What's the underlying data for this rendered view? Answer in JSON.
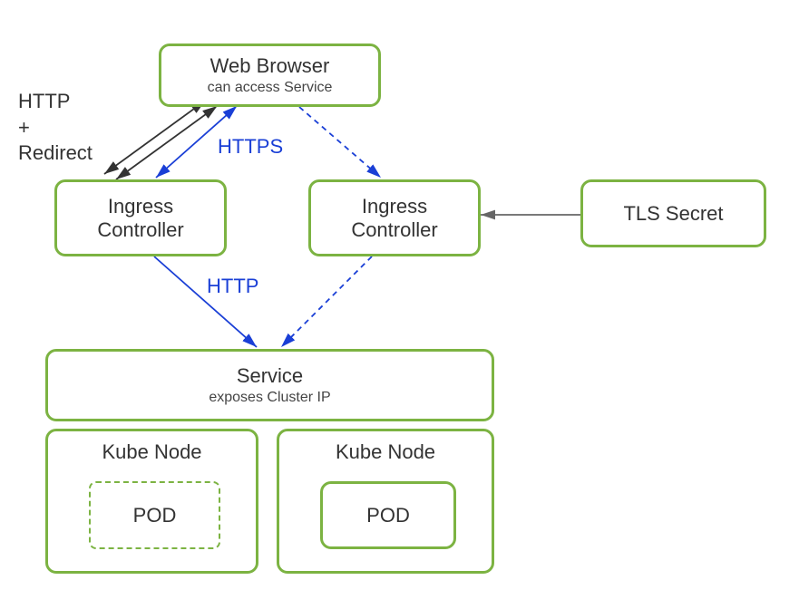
{
  "webBrowser": {
    "title": "Web Browser",
    "subtitle": "can access Service"
  },
  "ingressLeft": {
    "title": "Ingress",
    "subtitle": "Controller"
  },
  "ingressRight": {
    "title": "Ingress",
    "subtitle": "Controller"
  },
  "tlsSecret": {
    "title": "TLS Secret"
  },
  "service": {
    "title": "Service",
    "subtitle": "exposes Cluster IP"
  },
  "kubeNodeLeft": {
    "title": "Kube Node",
    "pod": "POD"
  },
  "kubeNodeRight": {
    "title": "Kube Node",
    "pod": "POD"
  },
  "labels": {
    "httpRedirect": "HTTP\n+\nRedirect",
    "https": "HTTPS",
    "http": "HTTP"
  }
}
